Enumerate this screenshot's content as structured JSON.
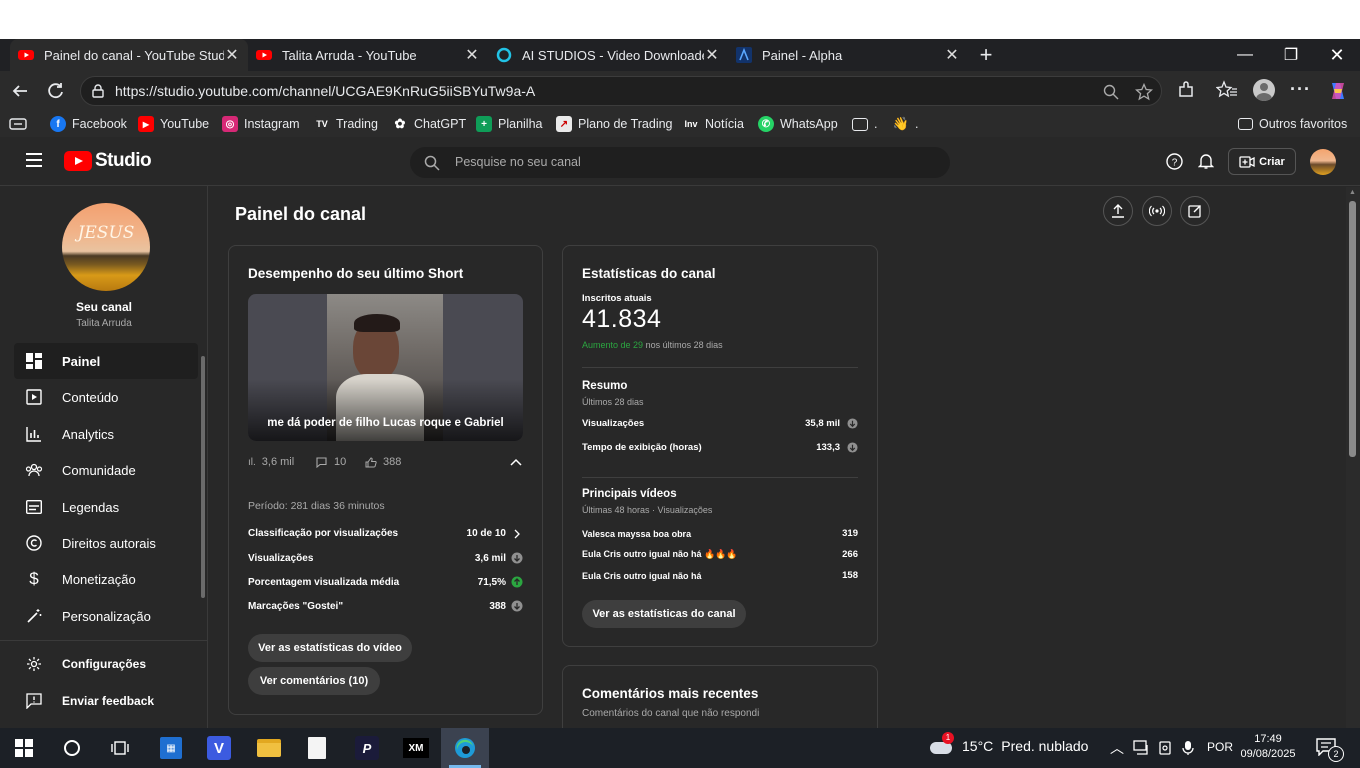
{
  "browser": {
    "tabs": [
      {
        "title": "Painel do canal - YouTube Studio",
        "active": true
      },
      {
        "title": "Talita Arruda - YouTube",
        "active": false
      },
      {
        "title": "AI STUDIOS - Video Downloader",
        "active": false
      },
      {
        "title": "Painel - Alpha",
        "active": false
      }
    ],
    "url": "https://studio.youtube.com/channel/UCGAE9KnRuG5iiSBYuTw9a-A",
    "bookmarks": [
      "Facebook",
      "YouTube",
      "Instagram",
      "Trading",
      "ChatGPT",
      "Planilha",
      "Plano de Trading",
      "Notícia",
      "WhatsApp"
    ],
    "bookmark_folders": [
      ".",
      "."
    ],
    "other_bookmarks": "Outros favoritos",
    "accent": "#ff0000"
  },
  "studio": {
    "logo_text": "Studio",
    "search_placeholder": "Pesquise no seu canal",
    "create_label": "Criar",
    "channel": {
      "avatar_text": "JESUS",
      "label": "Seu canal",
      "name": "Talita Arruda"
    },
    "nav": [
      {
        "label": "Painel",
        "icon": "dashboard-icon",
        "active": true
      },
      {
        "label": "Conteúdo",
        "icon": "content-icon"
      },
      {
        "label": "Analytics",
        "icon": "analytics-icon"
      },
      {
        "label": "Comunidade",
        "icon": "community-icon"
      },
      {
        "label": "Legendas",
        "icon": "subtitles-icon"
      },
      {
        "label": "Direitos autorais",
        "icon": "copyright-icon"
      },
      {
        "label": "Monetização",
        "icon": "dollar-icon"
      },
      {
        "label": "Personalização",
        "icon": "wand-icon"
      }
    ],
    "nav_bottom": [
      {
        "label": "Configurações",
        "icon": "gear-icon"
      },
      {
        "label": "Enviar feedback",
        "icon": "feedback-icon"
      }
    ],
    "page_title": "Painel do canal",
    "short_card": {
      "title": "Desempenho do seu último Short",
      "video_caption": "me dá poder de filho Lucas roque e Gabriel",
      "views": "3,6 mil",
      "comments": "10",
      "likes": "388",
      "period": "Período: 281 dias 36 minutos",
      "stats": [
        {
          "label": "Classificação por visualizações",
          "value": "10 de 10",
          "icon": "chevron-right-icon"
        },
        {
          "label": "Visualizações",
          "value": "3,6 mil",
          "icon": "arrow-down-circle-icon"
        },
        {
          "label": "Porcentagem visualizada média",
          "value": "71,5%",
          "icon": "arrow-up-circle-icon"
        },
        {
          "label": "Marcações \"Gostei\"",
          "value": "388",
          "icon": "arrow-down-circle-icon"
        }
      ],
      "btn_stats": "Ver as estatísticas do vídeo",
      "btn_comments": "Ver comentários (10)"
    },
    "channel_card": {
      "title": "Estatísticas do canal",
      "subs_label": "Inscritos atuais",
      "subs_value": "41.834",
      "growth_highlight": "Aumento de 29",
      "growth_rest": "nos últimos 28 dias",
      "summary_title": "Resumo",
      "summary_sub": "Últimos 28 dias",
      "summary_rows": [
        {
          "label": "Visualizações",
          "value": "35,8 mil"
        },
        {
          "label": "Tempo de exibição (horas)",
          "value": "133,3"
        }
      ],
      "top_title": "Principais vídeos",
      "top_sub": "Últimas 48 horas · Visualizações",
      "top_videos": [
        {
          "title": "Valesca mayssa boa obra",
          "value": "319"
        },
        {
          "title": "Eula Cris outro igual não há 🔥🔥🔥",
          "value": "266"
        },
        {
          "title": "Eula Cris outro igual não há",
          "value": "158"
        }
      ],
      "btn": "Ver as estatísticas do canal"
    },
    "comments_card": {
      "title": "Comentários mais recentes",
      "sub": "Comentários do canal que não respondi"
    }
  },
  "taskbar": {
    "weather_temp": "15°C",
    "weather_desc": "Pred. nublado",
    "weather_badge": "1",
    "lang": "POR",
    "time": "17:49",
    "date": "09/08/2025",
    "notif_count": "2"
  }
}
